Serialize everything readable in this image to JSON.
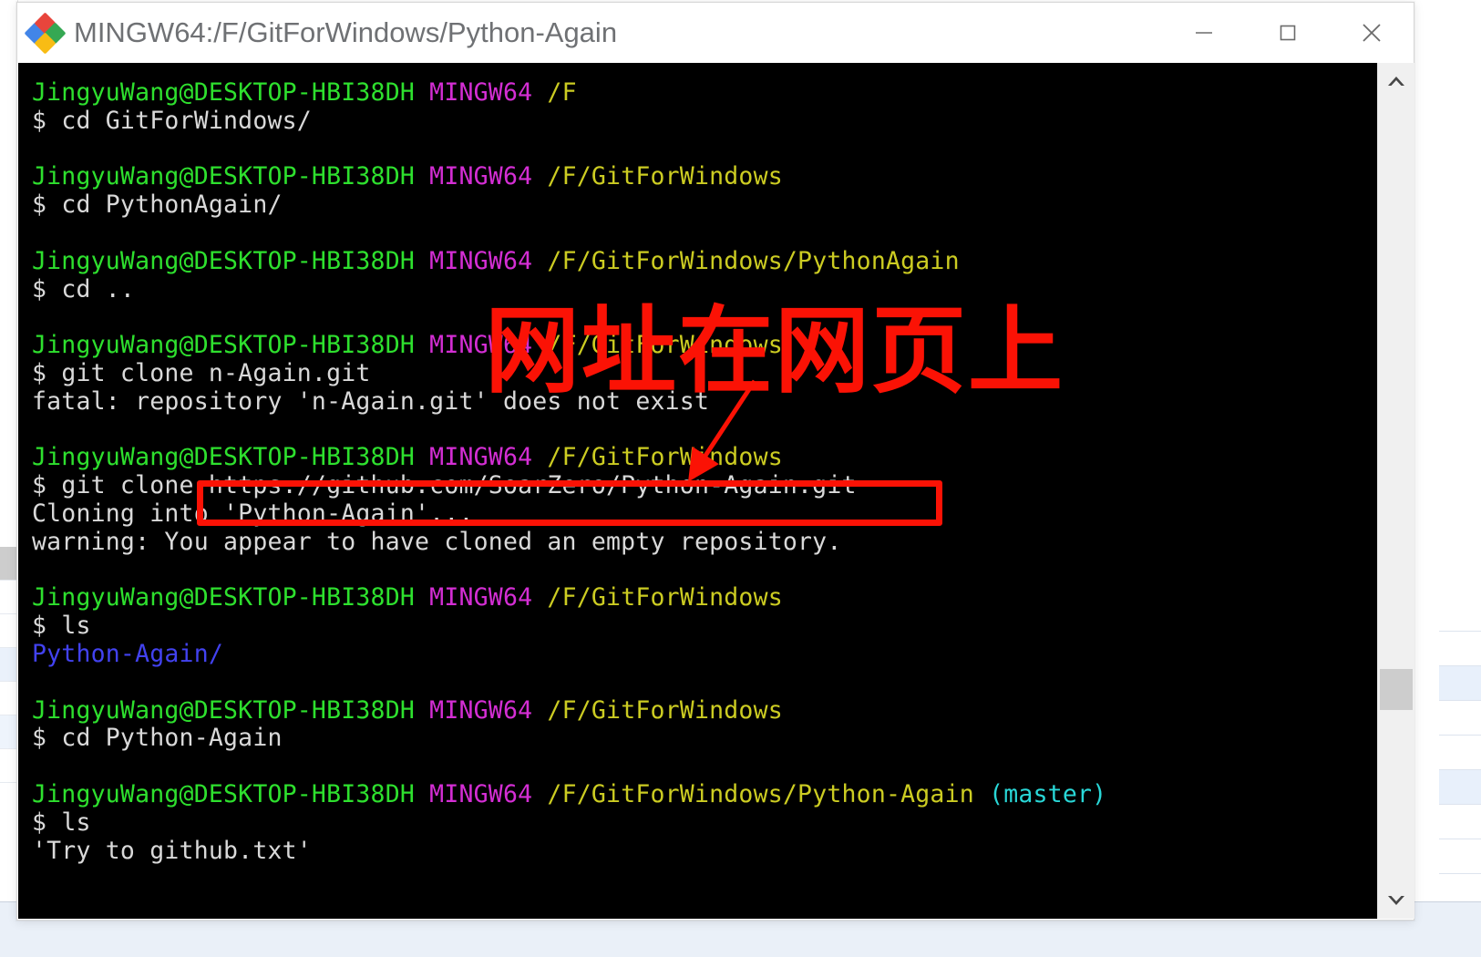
{
  "window": {
    "title": "MINGW64:/F/GitForWindows/Python-Again",
    "icon": "mintty-diamond-icon",
    "controls": {
      "minimize": "minimize-icon",
      "maximize": "maximize-icon",
      "close": "close-icon"
    }
  },
  "theme": {
    "terminal_background": "#000000",
    "prompt_user_color": "#2ee02e",
    "prompt_mingw_color": "#d42ed4",
    "prompt_path_color": "#cccc22",
    "prompt_branch_color": "#29d7d7",
    "directory_color": "#4242f0",
    "text_color": "#d9d9d9",
    "annotation_color": "#fb1205"
  },
  "prompt": {
    "user_host": "JingyuWang@DESKTOP-HBI38DH",
    "shell": "MINGW64",
    "dollar": "$"
  },
  "terminal": {
    "blocks": [
      {
        "prompt_path": "/F",
        "branch": "",
        "command": "cd GitForWindows/",
        "output": []
      },
      {
        "prompt_path": "/F/GitForWindows",
        "branch": "",
        "command": "cd PythonAgain/",
        "output": []
      },
      {
        "prompt_path": "/F/GitForWindows/PythonAgain",
        "branch": "",
        "command": "cd ..",
        "output": []
      },
      {
        "prompt_path": "/F/GitForWindows",
        "branch": "",
        "command": "git clone n-Again.git",
        "output": [
          {
            "text": "fatal: repository 'n-Again.git' does not exist",
            "style": "white"
          }
        ]
      },
      {
        "prompt_path": "/F/GitForWindows",
        "branch": "",
        "command": "git clone https://github.com/SoarZero/Python-Again.git",
        "output": [
          {
            "text": "Cloning into 'Python-Again'...",
            "style": "white"
          },
          {
            "text": "warning: You appear to have cloned an empty repository.",
            "style": "white"
          }
        ]
      },
      {
        "prompt_path": "/F/GitForWindows",
        "branch": "",
        "command": "ls",
        "output": [
          {
            "text": "Python-Again/",
            "style": "dir"
          }
        ]
      },
      {
        "prompt_path": "/F/GitForWindows",
        "branch": "",
        "command": "cd Python-Again",
        "output": []
      },
      {
        "prompt_path": "/F/GitForWindows/Python-Again",
        "branch": "(master)",
        "command": "ls",
        "output": [
          {
            "text": "'Try to github.txt'",
            "style": "white"
          }
        ]
      }
    ]
  },
  "annotation": {
    "text": "网址在网页上",
    "highlighted_url": "https://github.com/SoarZero/Python-Again.git",
    "arrow": "down-left-arrow"
  },
  "scrollbar": {
    "up_arrow": "chevron-up-icon",
    "down_arrow": "chevron-down-icon",
    "thumb": "scroll-thumb"
  }
}
